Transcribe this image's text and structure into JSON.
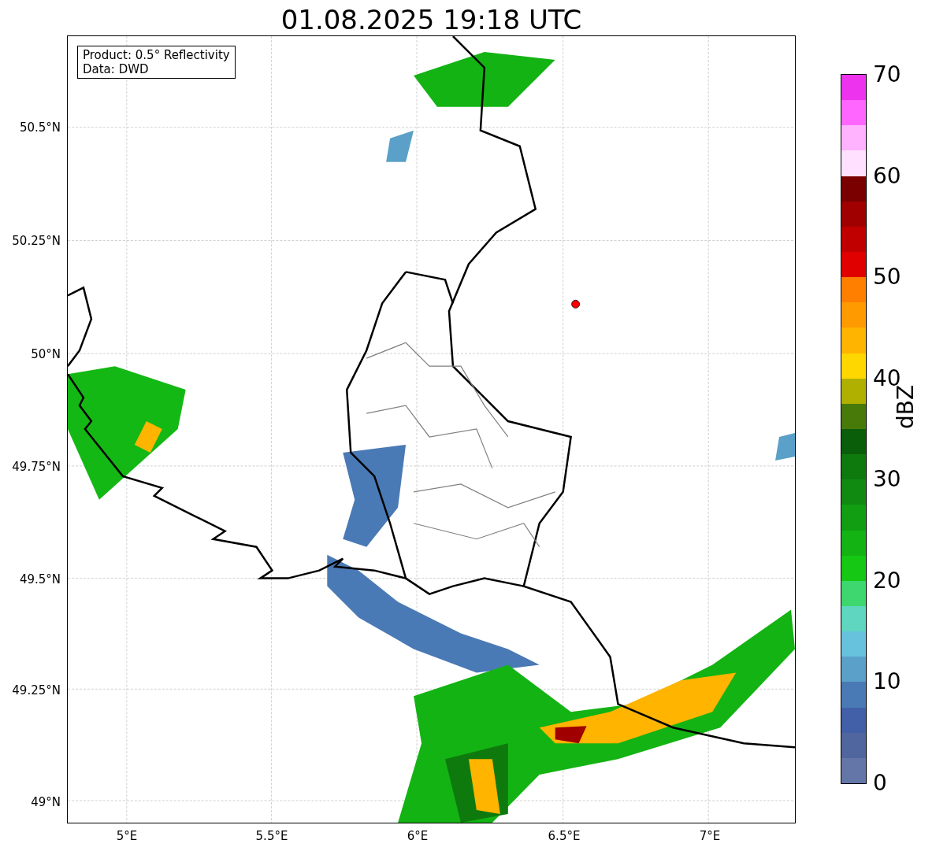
{
  "title": "01.08.2025 19:18 UTC",
  "info_box": {
    "lines": [
      "Product: 0.5° Reflectivity",
      "Data: DWD"
    ]
  },
  "map": {
    "x_ticks": [
      "5°E",
      "5.5°E",
      "6°E",
      "6.5°E",
      "7°E"
    ],
    "y_ticks": [
      "50.5°N",
      "50.25°N",
      "50°N",
      "49.75°N",
      "49.5°N",
      "49.25°N",
      "49°N"
    ]
  },
  "colorbar": {
    "label": "dBZ",
    "ticks": [
      "70",
      "60",
      "50",
      "40",
      "30",
      "20",
      "10",
      "0"
    ],
    "bins": [
      {
        "color": "#6476a8"
      },
      {
        "color": "#50669e"
      },
      {
        "color": "#4260a8"
      },
      {
        "color": "#4a7ab5"
      },
      {
        "color": "#5aa0c8"
      },
      {
        "color": "#66c2dd"
      },
      {
        "color": "#5ed6c0"
      },
      {
        "color": "#3ed66e"
      },
      {
        "color": "#14c814"
      },
      {
        "color": "#13b313"
      },
      {
        "color": "#129e12"
      },
      {
        "color": "#118a11"
      },
      {
        "color": "#0e7a0e"
      },
      {
        "color": "#0a5e0a"
      },
      {
        "color": "#487a0a"
      },
      {
        "color": "#b0b000"
      },
      {
        "color": "#ffd700"
      },
      {
        "color": "#ffb400"
      },
      {
        "color": "#ff9a00"
      },
      {
        "color": "#ff7f00"
      },
      {
        "color": "#e00000"
      },
      {
        "color": "#c00000"
      },
      {
        "color": "#a00000"
      },
      {
        "color": "#7a0000"
      },
      {
        "color": "#ffe0ff"
      },
      {
        "color": "#ffb3ff"
      },
      {
        "color": "#ff66ff"
      },
      {
        "color": "#ee33ee"
      }
    ]
  }
}
